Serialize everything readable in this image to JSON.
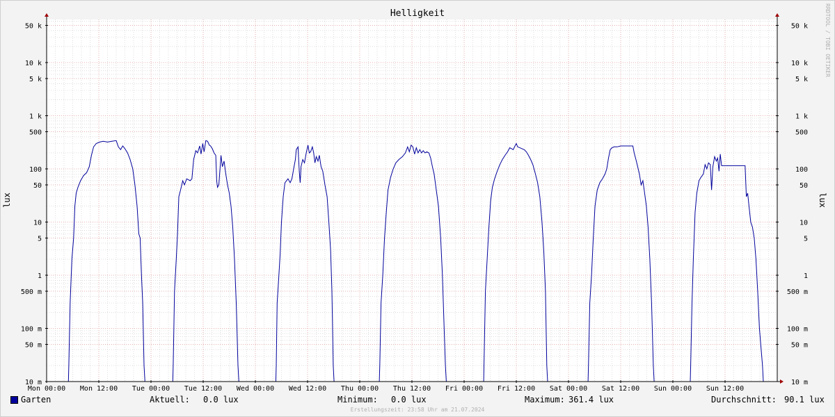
{
  "chart_data": {
    "type": "line",
    "title": "Helligkeit",
    "ylabel": "lux",
    "yscale": "log",
    "ylim": [
      0.01,
      60000
    ],
    "y_ticks": [
      {
        "value": 50000,
        "label": "50 k"
      },
      {
        "value": 10000,
        "label": "10 k"
      },
      {
        "value": 5000,
        "label": "5 k"
      },
      {
        "value": 1000,
        "label": "1 k"
      },
      {
        "value": 500,
        "label": "500"
      },
      {
        "value": 100,
        "label": "100"
      },
      {
        "value": 50,
        "label": "50"
      },
      {
        "value": 10,
        "label": "10"
      },
      {
        "value": 5,
        "label": "5"
      },
      {
        "value": 1,
        "label": "1"
      },
      {
        "value": 0.5,
        "label": "500 m"
      },
      {
        "value": 0.1,
        "label": "100 m"
      },
      {
        "value": 0.05,
        "label": "50 m"
      },
      {
        "value": 0.01,
        "label": "10 m"
      }
    ],
    "xlim": [
      0,
      168
    ],
    "x_unit": "hours since Mon 00:00",
    "x_ticks": [
      {
        "value": 0,
        "label": "Mon 00:00"
      },
      {
        "value": 12,
        "label": "Mon 12:00"
      },
      {
        "value": 24,
        "label": "Tue 00:00"
      },
      {
        "value": 36,
        "label": "Tue 12:00"
      },
      {
        "value": 48,
        "label": "Wed 00:00"
      },
      {
        "value": 60,
        "label": "Wed 12:00"
      },
      {
        "value": 72,
        "label": "Thu 00:00"
      },
      {
        "value": 84,
        "label": "Thu 12:00"
      },
      {
        "value": 96,
        "label": "Fri 00:00"
      },
      {
        "value": 108,
        "label": "Fri 12:00"
      },
      {
        "value": 120,
        "label": "Sat 00:00"
      },
      {
        "value": 132,
        "label": "Sat 12:00"
      },
      {
        "value": 144,
        "label": "Sun 00:00"
      },
      {
        "value": 156,
        "label": "Sun 12:00"
      }
    ],
    "grid": true,
    "series": [
      {
        "name": "Garten",
        "color": "#00009c",
        "points": [
          [
            0,
            0.01
          ],
          [
            5,
            0.01
          ],
          [
            5.1,
            0.02
          ],
          [
            5.4,
            0.3
          ],
          [
            5.8,
            2
          ],
          [
            6.2,
            5
          ],
          [
            6.5,
            20
          ],
          [
            6.8,
            35
          ],
          [
            7.2,
            45
          ],
          [
            7.8,
            60
          ],
          [
            8.5,
            75
          ],
          [
            9.2,
            85
          ],
          [
            9.8,
            110
          ],
          [
            10.3,
            180
          ],
          [
            10.8,
            260
          ],
          [
            11.4,
            300
          ],
          [
            12.2,
            320
          ],
          [
            13,
            330
          ],
          [
            14,
            320
          ],
          [
            15,
            330
          ],
          [
            16,
            340
          ],
          [
            16.5,
            260
          ],
          [
            17,
            230
          ],
          [
            17.5,
            270
          ],
          [
            18,
            240
          ],
          [
            18.6,
            200
          ],
          [
            19.2,
            150
          ],
          [
            19.8,
            100
          ],
          [
            20.3,
            50
          ],
          [
            20.8,
            20
          ],
          [
            21.2,
            6
          ],
          [
            21.5,
            5
          ],
          [
            21.8,
            1
          ],
          [
            22.1,
            0.3
          ],
          [
            22.4,
            0.02
          ],
          [
            22.6,
            0.01
          ],
          [
            29,
            0.01
          ],
          [
            29.1,
            0.02
          ],
          [
            29.4,
            0.5
          ],
          [
            29.8,
            2
          ],
          [
            30.1,
            6
          ],
          [
            30.4,
            30
          ],
          [
            30.8,
            40
          ],
          [
            31.3,
            60
          ],
          [
            31.7,
            50
          ],
          [
            32.2,
            65
          ],
          [
            33,
            60
          ],
          [
            33.4,
            65
          ],
          [
            33.8,
            150
          ],
          [
            34.3,
            220
          ],
          [
            34.7,
            200
          ],
          [
            35.2,
            270
          ],
          [
            35.5,
            190
          ],
          [
            35.9,
            300
          ],
          [
            36.2,
            210
          ],
          [
            36.6,
            340
          ],
          [
            37,
            330
          ],
          [
            37.4,
            280
          ],
          [
            37.7,
            270
          ],
          [
            38.1,
            240
          ],
          [
            38.5,
            200
          ],
          [
            38.9,
            180
          ],
          [
            39.1,
            60
          ],
          [
            39.3,
            45
          ],
          [
            39.6,
            50
          ],
          [
            40.1,
            180
          ],
          [
            40.4,
            110
          ],
          [
            40.8,
            140
          ],
          [
            41.2,
            80
          ],
          [
            41.6,
            50
          ],
          [
            42,
            35
          ],
          [
            42.4,
            20
          ],
          [
            42.8,
            8
          ],
          [
            43.2,
            2
          ],
          [
            43.6,
            0.3
          ],
          [
            44,
            0.02
          ],
          [
            44.2,
            0.01
          ],
          [
            52.7,
            0.01
          ],
          [
            52.8,
            0.02
          ],
          [
            53,
            0.3
          ],
          [
            53.4,
            1
          ],
          [
            53.7,
            2.5
          ],
          [
            54,
            10
          ],
          [
            54.4,
            30
          ],
          [
            54.8,
            55
          ],
          [
            55.5,
            65
          ],
          [
            56,
            55
          ],
          [
            56.4,
            65
          ],
          [
            56.8,
            100
          ],
          [
            57.2,
            150
          ],
          [
            57.4,
            230
          ],
          [
            57.8,
            260
          ],
          [
            58.1,
            90
          ],
          [
            58.3,
            55
          ],
          [
            58.5,
            110
          ],
          [
            58.9,
            150
          ],
          [
            59.3,
            130
          ],
          [
            59.7,
            200
          ],
          [
            60.1,
            280
          ],
          [
            60.4,
            200
          ],
          [
            60.7,
            210
          ],
          [
            61.1,
            260
          ],
          [
            61.4,
            200
          ],
          [
            61.7,
            130
          ],
          [
            62,
            170
          ],
          [
            62.4,
            140
          ],
          [
            62.7,
            180
          ],
          [
            63.1,
            110
          ],
          [
            63.5,
            90
          ],
          [
            64,
            50
          ],
          [
            64.5,
            30
          ],
          [
            64.9,
            10
          ],
          [
            65.3,
            3
          ],
          [
            65.6,
            0.5
          ],
          [
            65.9,
            0.02
          ],
          [
            66.1,
            0.01
          ],
          [
            76.5,
            0.01
          ],
          [
            76.6,
            0.02
          ],
          [
            76.9,
            0.3
          ],
          [
            77.3,
            1
          ],
          [
            77.7,
            5
          ],
          [
            78.1,
            15
          ],
          [
            78.5,
            40
          ],
          [
            79.1,
            70
          ],
          [
            79.7,
            100
          ],
          [
            80.3,
            130
          ],
          [
            81,
            150
          ],
          [
            81.8,
            170
          ],
          [
            82.5,
            200
          ],
          [
            83,
            260
          ],
          [
            83.4,
            210
          ],
          [
            83.8,
            280
          ],
          [
            84.2,
            260
          ],
          [
            84.6,
            190
          ],
          [
            85,
            250
          ],
          [
            85.4,
            200
          ],
          [
            85.8,
            230
          ],
          [
            86.2,
            200
          ],
          [
            86.6,
            220
          ],
          [
            87,
            200
          ],
          [
            87.4,
            210
          ],
          [
            87.9,
            200
          ],
          [
            88.3,
            160
          ],
          [
            88.7,
            110
          ],
          [
            89.1,
            80
          ],
          [
            89.6,
            40
          ],
          [
            90.1,
            20
          ],
          [
            90.6,
            5
          ],
          [
            91,
            1
          ],
          [
            91.4,
            0.1
          ],
          [
            91.7,
            0.02
          ],
          [
            91.9,
            0.01
          ],
          [
            100.5,
            0.01
          ],
          [
            100.6,
            0.03
          ],
          [
            100.9,
            0.5
          ],
          [
            101.3,
            2
          ],
          [
            101.7,
            8
          ],
          [
            102.1,
            25
          ],
          [
            102.5,
            45
          ],
          [
            103,
            65
          ],
          [
            103.6,
            90
          ],
          [
            104.2,
            120
          ],
          [
            104.8,
            150
          ],
          [
            105.4,
            180
          ],
          [
            106,
            210
          ],
          [
            106.5,
            250
          ],
          [
            106.9,
            240
          ],
          [
            107.3,
            230
          ],
          [
            107.7,
            270
          ],
          [
            108,
            300
          ],
          [
            108.3,
            260
          ],
          [
            108.8,
            250
          ],
          [
            109.3,
            240
          ],
          [
            109.8,
            230
          ],
          [
            110.3,
            210
          ],
          [
            110.8,
            180
          ],
          [
            111.3,
            150
          ],
          [
            111.8,
            120
          ],
          [
            112.4,
            80
          ],
          [
            112.9,
            55
          ],
          [
            113.4,
            30
          ],
          [
            113.9,
            10
          ],
          [
            114.3,
            3
          ],
          [
            114.7,
            0.5
          ],
          [
            115,
            0.02
          ],
          [
            115.2,
            0.01
          ],
          [
            124.5,
            0.01
          ],
          [
            124.6,
            0.02
          ],
          [
            124.9,
            0.3
          ],
          [
            125.3,
            1
          ],
          [
            125.7,
            5
          ],
          [
            126.1,
            20
          ],
          [
            126.6,
            40
          ],
          [
            127.2,
            55
          ],
          [
            127.8,
            65
          ],
          [
            128.4,
            80
          ],
          [
            128.8,
            100
          ],
          [
            129.2,
            160
          ],
          [
            129.6,
            230
          ],
          [
            130,
            250
          ],
          [
            130.5,
            260
          ],
          [
            131.2,
            260
          ],
          [
            132,
            270
          ],
          [
            133,
            270
          ],
          [
            134,
            270
          ],
          [
            134.8,
            270
          ],
          [
            135.1,
            200
          ],
          [
            135.5,
            150
          ],
          [
            135.9,
            110
          ],
          [
            136.3,
            80
          ],
          [
            136.7,
            50
          ],
          [
            137.1,
            60
          ],
          [
            137.5,
            35
          ],
          [
            137.9,
            20
          ],
          [
            138.3,
            8
          ],
          [
            138.7,
            2
          ],
          [
            139.1,
            0.3
          ],
          [
            139.5,
            0.02
          ],
          [
            139.7,
            0.01
          ],
          [
            148,
            0.01
          ],
          [
            148.1,
            0.02
          ],
          [
            148.4,
            0.3
          ],
          [
            148.7,
            2
          ],
          [
            149.1,
            15
          ],
          [
            149.5,
            35
          ],
          [
            150,
            60
          ],
          [
            150.5,
            70
          ],
          [
            151,
            80
          ],
          [
            151.4,
            120
          ],
          [
            151.8,
            100
          ],
          [
            152.2,
            130
          ],
          [
            152.6,
            120
          ],
          [
            152.9,
            40
          ],
          [
            153.2,
            110
          ],
          [
            153.6,
            170
          ],
          [
            154,
            140
          ],
          [
            154.3,
            160
          ],
          [
            154.6,
            90
          ],
          [
            154.9,
            190
          ],
          [
            155.2,
            115
          ],
          [
            156,
            115
          ],
          [
            157,
            115
          ],
          [
            158,
            115
          ],
          [
            159,
            115
          ],
          [
            160,
            115
          ],
          [
            160.6,
            115
          ],
          [
            160.9,
            30
          ],
          [
            161.2,
            35
          ],
          [
            161.5,
            20
          ],
          [
            161.9,
            10
          ],
          [
            162.3,
            8
          ],
          [
            162.7,
            5
          ],
          [
            163.1,
            2
          ],
          [
            163.5,
            0.5
          ],
          [
            163.9,
            0.1
          ],
          [
            164.3,
            0.04
          ],
          [
            164.6,
            0.02
          ],
          [
            164.8,
            0.01
          ],
          [
            168,
            0.01
          ]
        ]
      }
    ]
  },
  "legend": {
    "series_name": "Garten",
    "aktuell_label": "Aktuell:",
    "aktuell_value": "0.0 lux",
    "minimum_label": "Minimum:",
    "minimum_value": "0.0 lux",
    "maximum_label": "Maximum:",
    "maximum_value": "361.4 lux",
    "durchschnitt_label": "Durchschnitt:",
    "durchschnitt_value": "90.1 lux"
  },
  "footer": "Erstellungszeit: 23:58 Uhr am 21.07.2024",
  "watermark": "RRDTOOL / TOBI OETIKER",
  "colors": {
    "line": "#00009c",
    "major_grid": "#e8a0a0",
    "minor_grid": "#c8c8c8",
    "plot_bg": "#ffffff",
    "page_bg": "#f3f3f3",
    "arrow": "#a00000"
  }
}
